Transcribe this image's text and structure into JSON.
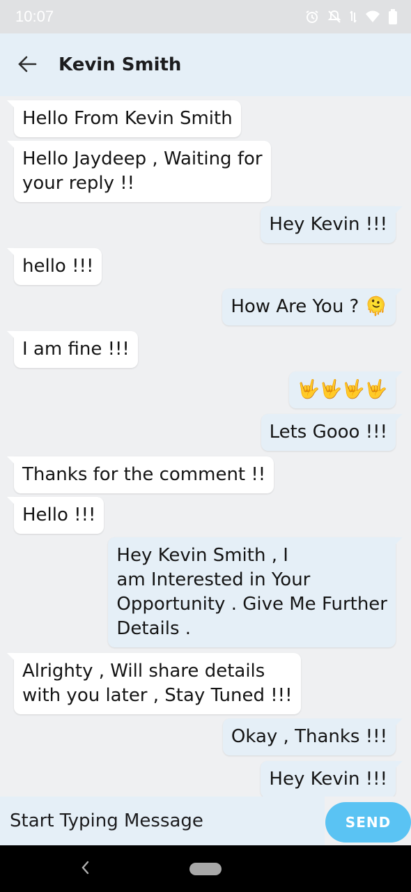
{
  "status_bar": {
    "time": "10:07",
    "icons": [
      "alarm-icon",
      "mute-icon",
      "data-icon",
      "wifi-icon",
      "battery-icon"
    ]
  },
  "header": {
    "back_icon": "arrow-left-icon",
    "contact_name": "Kevin Smith"
  },
  "messages": [
    {
      "direction": "incoming",
      "text": "Hello From Kevin Smith"
    },
    {
      "direction": "incoming",
      "text": "Hello Jaydeep , Waiting for\nyour reply !!"
    },
    {
      "direction": "outgoing",
      "text": "Hey Kevin !!!"
    },
    {
      "direction": "incoming",
      "text": "hello !!!"
    },
    {
      "direction": "outgoing",
      "text": "How Are You ? 🫠"
    },
    {
      "direction": "incoming",
      "text": "I am fine !!!"
    },
    {
      "direction": "outgoing",
      "text": "🤟🤟🤟🤟"
    },
    {
      "direction": "outgoing",
      "text": "Lets Gooo !!!"
    },
    {
      "direction": "incoming",
      "text": "Thanks for the comment !!"
    },
    {
      "direction": "incoming",
      "text": "Hello !!!"
    },
    {
      "direction": "outgoing",
      "text": "Hey Kevin Smith , I\nam Interested in Your\nOpportunity . Give Me Further\nDetails ."
    },
    {
      "direction": "incoming",
      "text": "Alrighty  , Will share details\nwith you later , Stay Tuned !!!"
    },
    {
      "direction": "outgoing",
      "text": "Okay , Thanks !!!"
    },
    {
      "direction": "outgoing",
      "text": "Hey Kevin !!!"
    }
  ],
  "composer": {
    "placeholder": "Start Typing Message",
    "value": "",
    "send_label": "SEND"
  },
  "navigation": {
    "back_icon": "nav-back-icon",
    "home_icon": "home-pill-icon"
  },
  "colors": {
    "incoming_bubble": "#ffffff",
    "outgoing_bubble": "#e5eff7",
    "header_background": "#e5eff7",
    "send_button": "#5ac3f3",
    "chat_background": "#eff0f2"
  }
}
